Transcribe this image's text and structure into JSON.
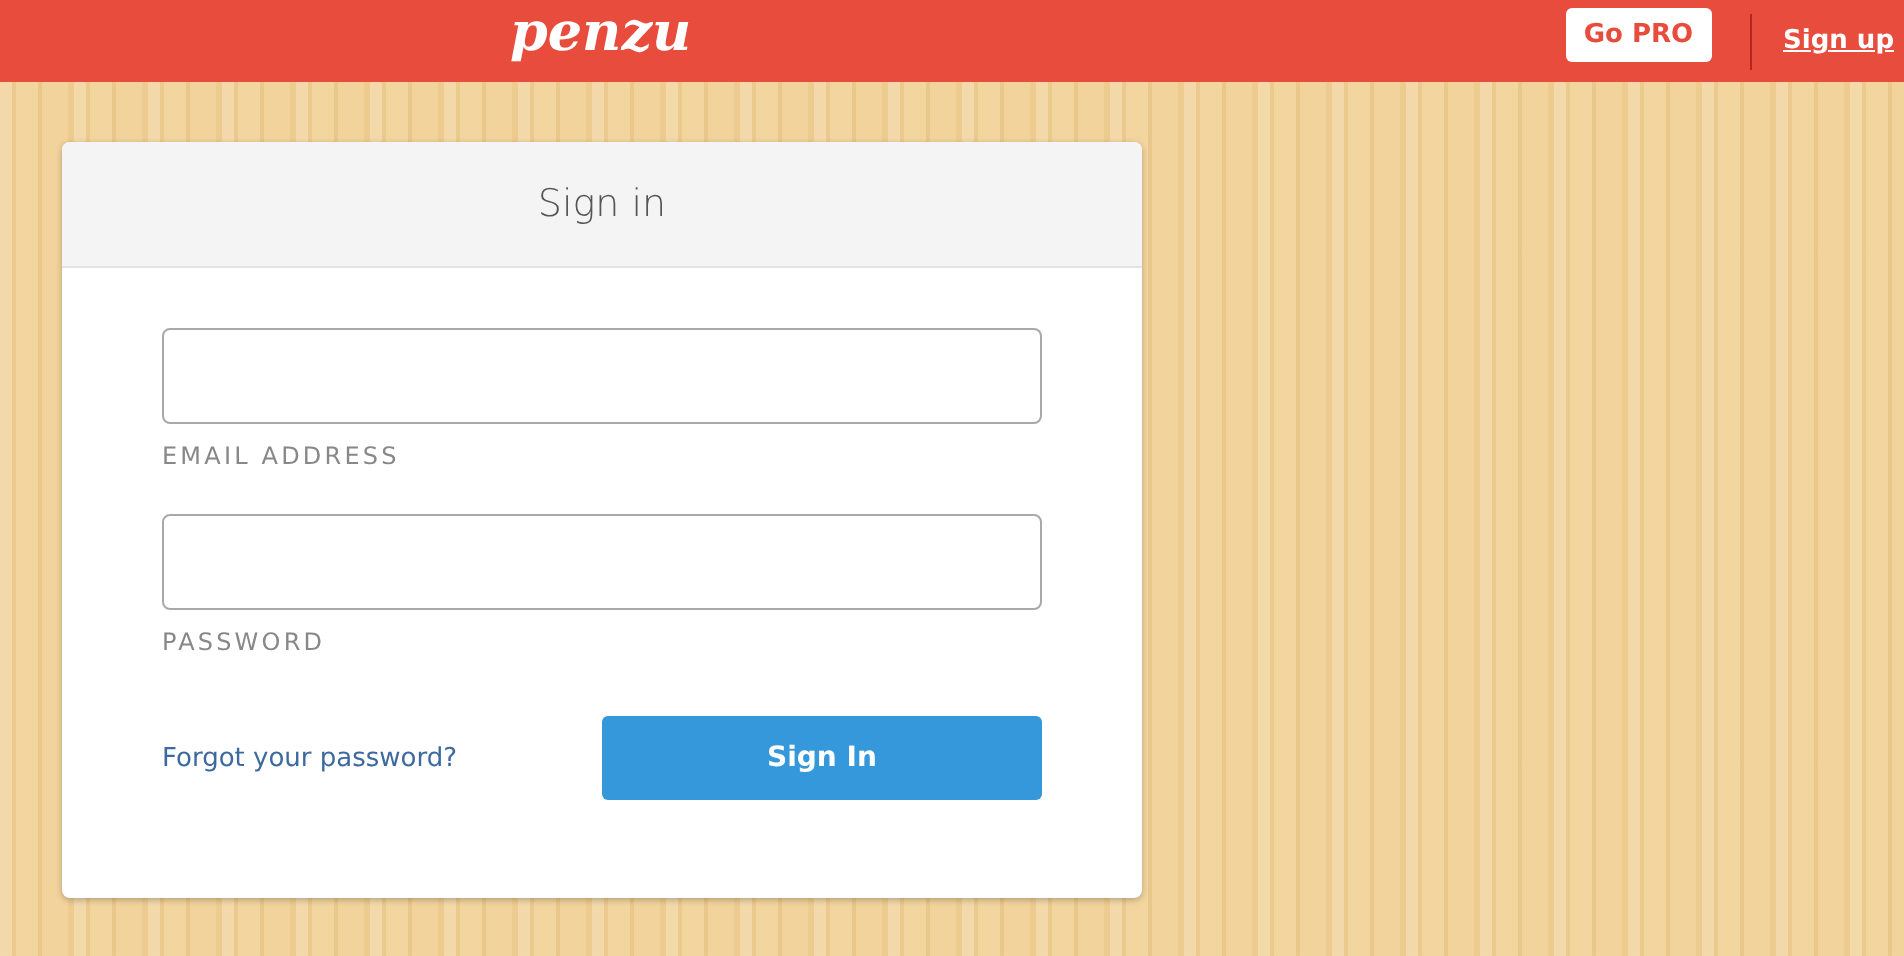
{
  "header": {
    "logo": "penzu",
    "pro_button": "Go PRO",
    "signup_link": "Sign up"
  },
  "signin": {
    "title": "Sign in",
    "fields": [
      {
        "label": "EMAIL ADDRESS"
      },
      {
        "label": "PASSWORD"
      }
    ],
    "forgot_link": "Forgot your password?",
    "submit": "Sign In"
  }
}
